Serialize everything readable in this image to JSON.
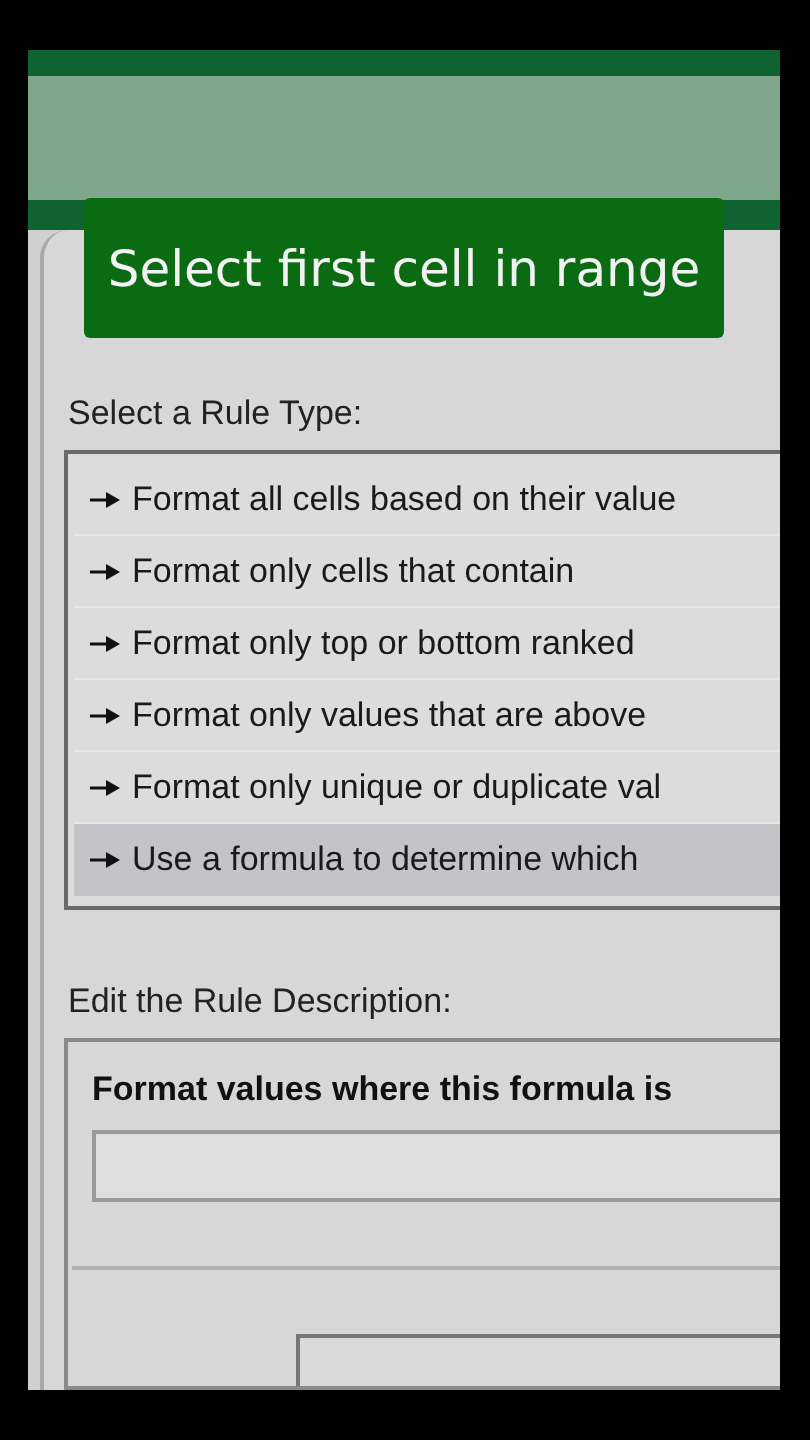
{
  "caption": "Select first cell in range",
  "rule_type": {
    "label": "Select a Rule Type:",
    "items": [
      {
        "label": "Format all cells based on their value",
        "selected": false
      },
      {
        "label": "Format only cells that contain",
        "selected": false
      },
      {
        "label": "Format only top or bottom ranked",
        "selected": false
      },
      {
        "label": "Format only values that are above",
        "selected": false
      },
      {
        "label": "Format only unique or duplicate val",
        "selected": false
      },
      {
        "label": "Use a formula to determine which",
        "selected": true
      }
    ]
  },
  "rule_description": {
    "label": "Edit the Rule Description:",
    "formula_label": "Format values where this formula is"
  }
}
